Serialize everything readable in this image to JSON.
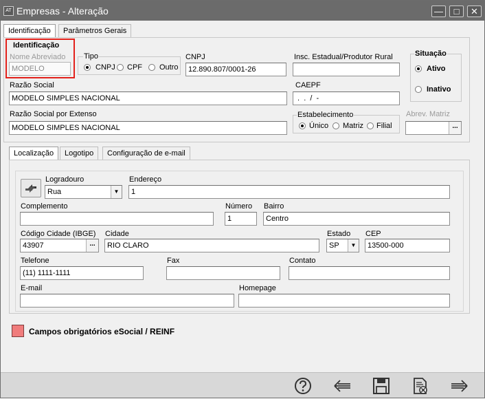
{
  "window": {
    "app_icon": "AT",
    "title": "Empresas - Alteração"
  },
  "top_tabs": [
    "Identificação",
    "Parâmetros Gerais"
  ],
  "ident": {
    "group_title": "Identificação",
    "nome_abreviado_label": "Nome Abreviado",
    "nome_abreviado_value": "MODELO",
    "tipo_label": "Tipo",
    "tipo_options": [
      "CNPJ",
      "CPF",
      "Outro"
    ],
    "tipo_selected": "CNPJ",
    "cnpj_label": "CNPJ",
    "cnpj_value": "12.890.807/0001-26",
    "insc_label": "Insc. Estadual/Produtor Rural",
    "insc_value": "",
    "situacao_label": "Situação",
    "situacao_options": [
      "Ativo",
      "Inativo"
    ],
    "situacao_selected": "Ativo",
    "razao_label": "Razão Social",
    "razao_value": "MODELO SIMPLES NACIONAL",
    "caepf_label": "CAEPF",
    "caepf_value": " .  .  /  -",
    "razao_ext_label": "Razão Social por Extenso",
    "razao_ext_value": "MODELO SIMPLES NACIONAL",
    "estab_label": "Estabelecimento",
    "estab_options": [
      "Único",
      "Matriz",
      "Filial"
    ],
    "estab_selected": "Único",
    "abrev_matriz_label": "Abrev. Matriz",
    "abrev_matriz_value": ""
  },
  "inner_tabs": [
    "Localização",
    "Logotipo",
    "Configuração de e-mail"
  ],
  "loc": {
    "logradouro_label": "Logradouro",
    "logradouro_value": "Rua",
    "endereco_label": "Endereço",
    "endereco_value": "1",
    "complemento_label": "Complemento",
    "complemento_value": "",
    "numero_label": "Número",
    "numero_value": "1",
    "bairro_label": "Bairro",
    "bairro_value": "Centro",
    "cod_cidade_label": "Código Cidade (IBGE)",
    "cod_cidade_value": "43907",
    "cidade_label": "Cidade",
    "cidade_value": "RIO CLARO",
    "estado_label": "Estado",
    "estado_value": "SP",
    "cep_label": "CEP",
    "cep_value": "13500-000",
    "telefone_label": "Telefone",
    "telefone_value": "(11) 1111-1111",
    "fax_label": "Fax",
    "fax_value": "",
    "contato_label": "Contato",
    "contato_value": "",
    "email_label": "E-mail",
    "email_value": "",
    "homepage_label": "Homepage",
    "homepage_value": ""
  },
  "legend": {
    "text": "Campos obrigatórios eSocial / REINF",
    "color": "#f07c7c"
  },
  "toolbar": [
    "help-icon",
    "back-arrow-icon",
    "save-icon",
    "cancel-document-icon",
    "forward-arrow-icon"
  ],
  "colors": {
    "highlight_border": "#e3201a",
    "titlebar": "#6b6b6b"
  }
}
